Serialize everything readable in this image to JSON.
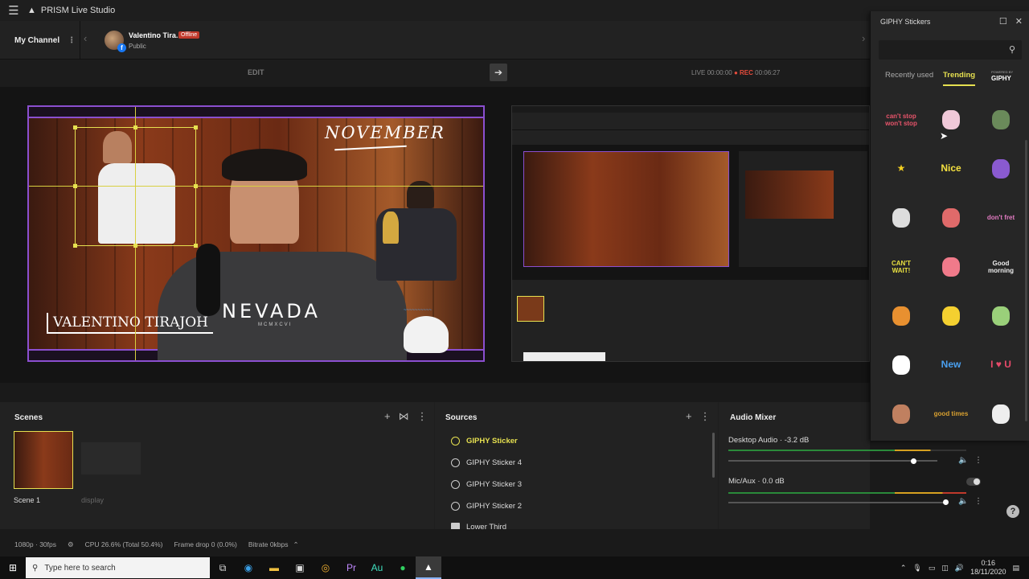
{
  "app": {
    "name": "PRISM Live Studio"
  },
  "channel": {
    "my_channel_label": "My Channel",
    "user_name": "Valentino Tira...",
    "status_badge": "Offline",
    "visibility": "Public"
  },
  "status": {
    "edit_label": "EDIT",
    "live_label": "LIVE",
    "live_time": "00:00:00",
    "rec_label": "REC",
    "rec_time": "00:06:27"
  },
  "canvas": {
    "month_text": "NOVEMBER",
    "lower_third": "VALENTINO TIRAJOH",
    "shirt_text": "NEVADA",
    "shirt_subtext": "MCMXCVI"
  },
  "scenes": {
    "header": "Scenes",
    "items": [
      {
        "label": "Scene 1",
        "selected": true
      },
      {
        "label": "display",
        "selected": false
      }
    ]
  },
  "sources": {
    "header": "Sources",
    "items": [
      {
        "label": "GIPHY Sticker",
        "active": true
      },
      {
        "label": "GIPHY Sticker 4",
        "active": false
      },
      {
        "label": "GIPHY Sticker 3",
        "active": false
      },
      {
        "label": "GIPHY Sticker 2",
        "active": false
      },
      {
        "label": "Lower Third",
        "active": false
      }
    ]
  },
  "audio": {
    "header": "Audio Mixer",
    "channels": [
      {
        "label": "Desktop Audio · -3.2 dB",
        "level": 0.85
      },
      {
        "label": "Mic/Aux · 0.0 dB",
        "level": 0.99
      }
    ]
  },
  "statusbar": {
    "resolution": "1080p · 30fps",
    "cpu": "CPU 26.6% (Total 50.4%)",
    "frame_drop": "Frame drop 0 (0.0%)",
    "bitrate": "Bitrate 0kbps"
  },
  "giphy": {
    "title": "GIPHY Stickers",
    "tabs": [
      "Recently used",
      "Trending"
    ],
    "active_tab": "Trending",
    "powered_by": "GIPHY",
    "powered_small": "POWERED BY",
    "stickers": [
      {
        "name": "cant-stop-sticker",
        "text": "can't stop won't stop",
        "color": "#e8546b"
      },
      {
        "name": "hat-face-sticker",
        "text": "",
        "color": "#f0c8d8"
      },
      {
        "name": "zombie-sticker",
        "text": "",
        "color": "#6a8a5a"
      },
      {
        "name": "star-sticker",
        "text": "★",
        "color": "#f4d020"
      },
      {
        "name": "nice-sticker",
        "text": "Nice",
        "color": "#f4e040"
      },
      {
        "name": "phone-sticker",
        "text": "",
        "color": "#8a5ad0"
      },
      {
        "name": "robot-sticker",
        "text": "",
        "color": "#dddddd"
      },
      {
        "name": "plant-sticker",
        "text": "",
        "color": "#e06a6a"
      },
      {
        "name": "dont-fret-sticker",
        "text": "don't fret",
        "color": "#e07ac0"
      },
      {
        "name": "cant-wait-sticker",
        "text": "CAN'T WAIT!",
        "color": "#e8e040"
      },
      {
        "name": "flower-sticker",
        "text": "",
        "color": "#f07a8a"
      },
      {
        "name": "good-morning-sticker",
        "text": "Good morning",
        "color": "#eeeeee"
      },
      {
        "name": "cat-sticker",
        "text": "",
        "color": "#e89030"
      },
      {
        "name": "sun-sticker",
        "text": "",
        "color": "#f4d030"
      },
      {
        "name": "cartoon-sticker",
        "text": "",
        "color": "#9ad07a"
      },
      {
        "name": "speech-bubble-sticker",
        "text": "",
        "color": "#ffffff"
      },
      {
        "name": "new-sticker",
        "text": "New",
        "color": "#4aa0f0"
      },
      {
        "name": "i-love-u-sticker",
        "text": "I ♥ U",
        "color": "#e84a6a"
      },
      {
        "name": "hand-sticker",
        "text": "",
        "color": "#c08060"
      },
      {
        "name": "good-times-sticker",
        "text": "good times",
        "color": "#d8a030"
      },
      {
        "name": "bear-sticker",
        "text": "",
        "color": "#eeeeee"
      }
    ]
  },
  "taskbar": {
    "search_placeholder": "Type here to search",
    "time": "0:16",
    "date": "18/11/2020"
  }
}
